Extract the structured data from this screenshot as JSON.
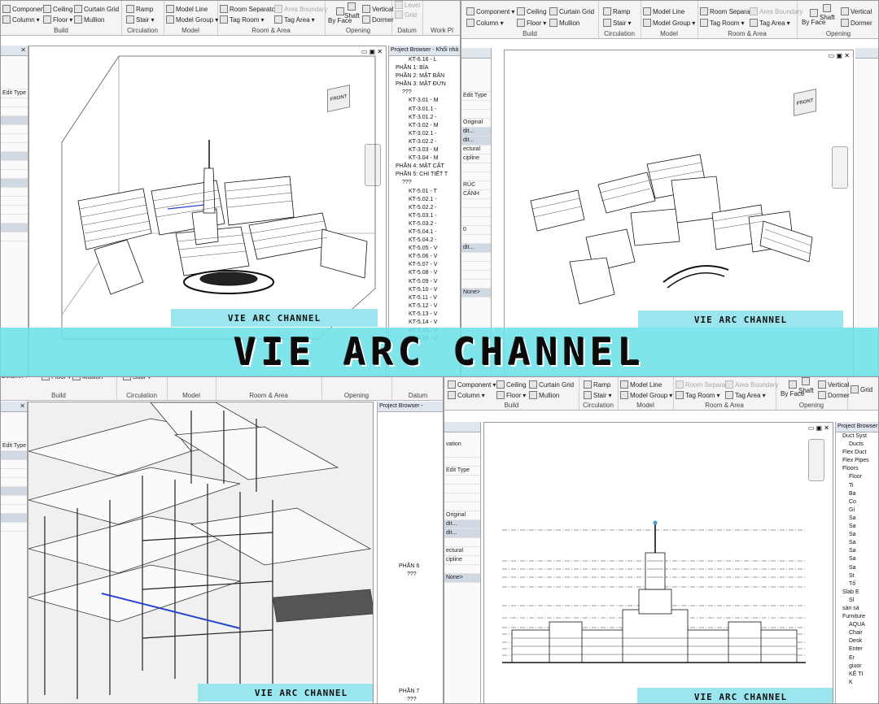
{
  "ribbon": {
    "build": {
      "component": "Component",
      "column": "Column",
      "ceiling": "Ceiling",
      "floor": "Floor",
      "curtain_grid": "Curtain Grid",
      "mullion": "Mullion",
      "label": "Build"
    },
    "circulation": {
      "ramp": "Ramp",
      "stair": "Stair",
      "label": "Circulation"
    },
    "model": {
      "model_line": "Model Line",
      "model_group": "Model Group",
      "label": "Model"
    },
    "room_area": {
      "room_separator": "Room Separator",
      "area_boundary": "Area Boundary",
      "room": "Room",
      "tag_room": "Tag Room",
      "tag_area": "Tag Area",
      "label": "Room & Area"
    },
    "opening": {
      "by_face": "By Face",
      "shaft": "Shaft",
      "vertical": "Vertical",
      "dormer": "Dormer",
      "label": "Opening"
    },
    "datum": {
      "level": "Level",
      "grid": "Grid",
      "label": "Datum"
    },
    "work_plane": {
      "label": "Work Pl"
    }
  },
  "properties": {
    "edit_type": "Edit Type",
    "original": "Original",
    "edit": "dit...",
    "structural": "ectural",
    "discipline": "cipline",
    "elevation": "vation",
    "none": "None>",
    "ruc": "RÚC",
    "canh": "CẢNH",
    "num": "0"
  },
  "browser_tl": {
    "title": "Project Browser - Khối nhà c",
    "items": [
      "KT-6.16 - L",
      "PHẦN 1: BÌA",
      "PHẦN 2: MẶT BẰN",
      "PHẦN 3: MẶT ĐỨN",
      "???",
      "KT-3.01 - M",
      "KT-3.01.1 -",
      "KT-3.01.2 -",
      "KT-3.02 - M",
      "KT-3.02.1 -",
      "KT-3.02.2 -",
      "KT-3.03 - M",
      "KT-3.04 - M",
      "PHẦN 4: MẶT CẮT",
      "PHẦN 5: CHI TIẾT T",
      "???",
      "KT-5.01 - T",
      "KT-5.02.1 -",
      "KT-5.02.2 -",
      "KT-5.03.1 -",
      "KT-5.03.2 -",
      "KT-5.04.1 -",
      "KT-5.04.2 -",
      "KT-5.05 - V",
      "KT-5.06 - V",
      "KT-5.07 - V",
      "KT-5.08 - V",
      "KT-5.09 - V",
      "KT-5.10 - V",
      "KT-5.11 - V",
      "KT-5.12 - V",
      "KT-5.13 - V",
      "KT-5.14 - V",
      "KT-5.15 - V",
      "KT-5.16 - V"
    ]
  },
  "browser_bl": {
    "title": "Project Browser -",
    "items": [
      "PHẦN 6",
      "???",
      "PHẦN 7",
      "???"
    ]
  },
  "browser_br": {
    "title": "Project Browser - K",
    "items": [
      "Duct Syst",
      "Ducts",
      "Flex Duct",
      "Flex Pipes",
      "Floors",
      "Floor",
      "Ti",
      "Ba",
      "Co",
      "Gi",
      "Sa",
      "Sa",
      "Sa",
      "Sa",
      "Sa",
      "Sa",
      "Sa",
      "St",
      "Tổ",
      "Slab E",
      "Sl",
      "sàn sá",
      "Furniture",
      "AQUA",
      "Chair",
      "Desk",
      "Enter",
      "Er",
      "giuor",
      "KỆ TI",
      "K"
    ]
  },
  "view": {
    "cube_face": "FRONT"
  },
  "watermark": {
    "small": "VIE ARC CHANNEL",
    "banner": "VIE ARC CHANNEL"
  },
  "colors": {
    "banner": "#6ee1e8",
    "ribbon_bg": "#f4f4f4",
    "panel_title": "#dfe6ee"
  }
}
